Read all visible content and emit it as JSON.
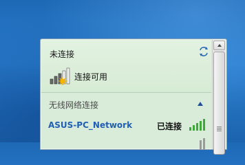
{
  "panel": {
    "status_text": "未连接",
    "connection_available_label": "连接可用",
    "refresh_icon": "refresh-arrows-icon",
    "wifi_icon": "wifi-signal-star-icon"
  },
  "wireless_section": {
    "header": "无线网络连接",
    "collapse_icon": "chevron-up-icon",
    "networks": [
      {
        "name": "ASUS-PC_Network",
        "status": "已连接",
        "signal_icon": "wifi-signal-icon"
      },
      {
        "name": "",
        "status": "",
        "signal_icon": "wifi-signal-icon"
      }
    ]
  },
  "colors": {
    "panel_bg": "#d9ecd9",
    "network_name": "#1f5fb5",
    "signal_green": "#3fa83a"
  }
}
